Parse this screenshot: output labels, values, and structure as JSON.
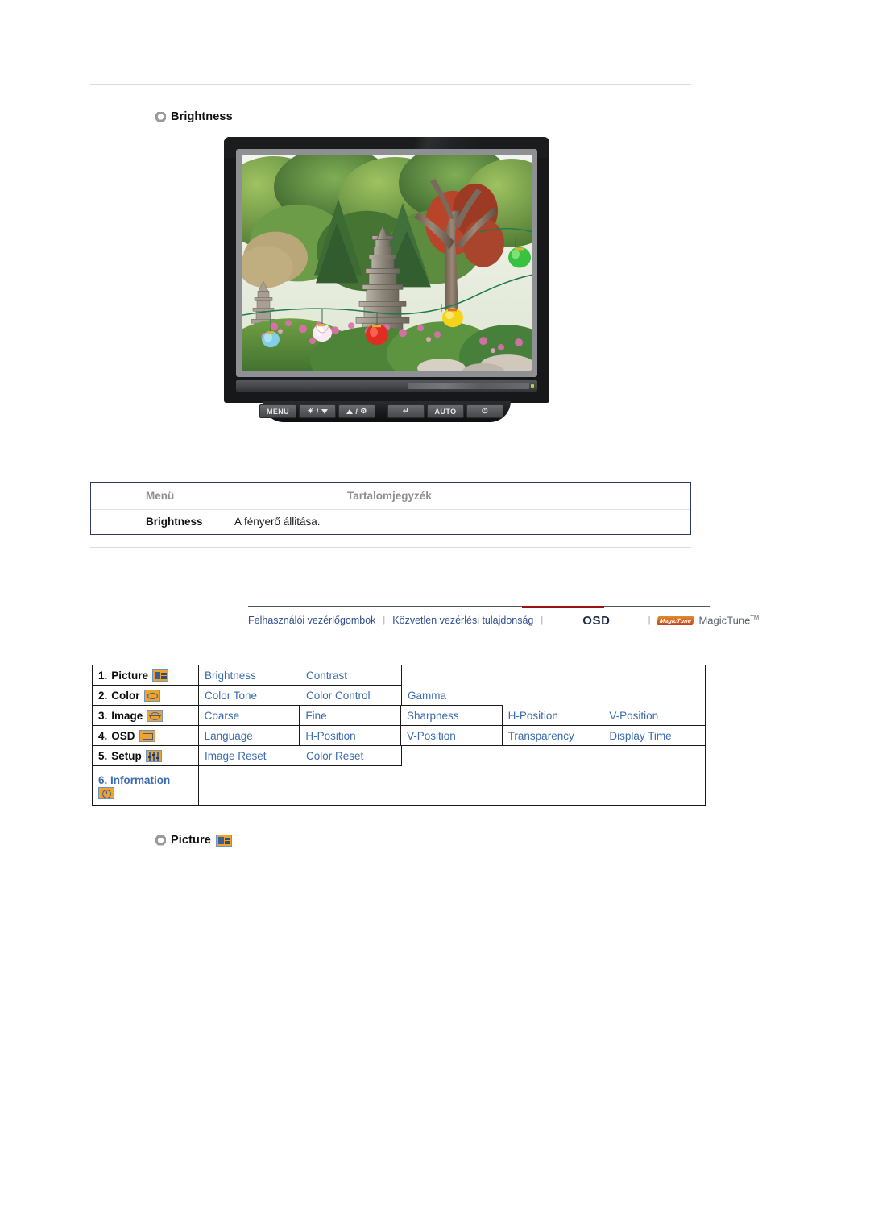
{
  "headings": {
    "brightness": "Brightness",
    "picture": "Picture"
  },
  "monitor": {
    "buttons": [
      {
        "name": "menu-button",
        "label": "MENU"
      },
      {
        "name": "brightness-down-button",
        "label": ""
      },
      {
        "name": "brightness-up-button",
        "label": ""
      },
      {
        "name": "enter-button",
        "label": ""
      },
      {
        "name": "auto-button",
        "label": "AUTO"
      },
      {
        "name": "power-button",
        "label": ""
      }
    ],
    "enter_glyph": "↵",
    "power_glyph": "⏻",
    "sun_glyph": "☀",
    "menu_marks": "III"
  },
  "info_table": {
    "headers": {
      "menu": "Menü",
      "toc": "Tartalomjegyzék"
    },
    "rows": [
      {
        "menu": "Brightness",
        "toc": "A fényerő állitása."
      }
    ]
  },
  "navbar": {
    "links": [
      {
        "label": "Felhasználói vezérlőgombok"
      },
      {
        "label": "Közvetlen vezérlési tulajdonság"
      }
    ],
    "separator": "|",
    "active": "OSD",
    "magictune_badge": "MagicTune",
    "magictune": "MagicTune",
    "tm": "TM",
    "accent_color": "#9b1414",
    "link_color": "#2f4f8f"
  },
  "osd_menu": {
    "rows": [
      {
        "number": "1.",
        "label": "Picture",
        "icon": "picture-icon",
        "items": [
          "Brightness",
          "Contrast"
        ]
      },
      {
        "number": "2.",
        "label": "Color",
        "icon": "color-icon",
        "items": [
          "Color Tone",
          "Color Control",
          "Gamma"
        ]
      },
      {
        "number": "3.",
        "label": "Image",
        "icon": "image-icon",
        "items": [
          "Coarse",
          "Fine",
          "Sharpness",
          "H-Position",
          "V-Position"
        ]
      },
      {
        "number": "4.",
        "label": "OSD",
        "icon": "osd-icon",
        "items": [
          "Language",
          "H-Position",
          "V-Position",
          "Transparency",
          "Display Time"
        ]
      },
      {
        "number": "5.",
        "label": "Setup",
        "icon": "setup-icon",
        "items": [
          "Image Reset",
          "Color Reset"
        ]
      },
      {
        "number": "6.",
        "label": "Information",
        "icon": "information-icon",
        "items": []
      }
    ],
    "text_color": "#3b6bb0",
    "icon_color": "#f0a32a"
  }
}
